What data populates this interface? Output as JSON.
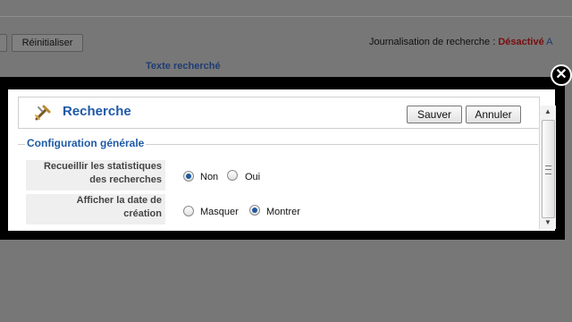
{
  "background": {
    "reset_button": "Réinitialiser",
    "status_prefix": "Journalisation de recherche : ",
    "status_value": "Désactivé",
    "status_extra": "A",
    "heading": "Texte recherché"
  },
  "modal": {
    "title": "Recherche",
    "save_label": "Sauver",
    "cancel_label": "Annuler",
    "close_symbol": "✕",
    "section_title": "Configuration générale",
    "rows": [
      {
        "label_line1": "Recueillir les statistiques",
        "label_line2": "des recherches",
        "options": [
          {
            "label": "Non",
            "checked": true
          },
          {
            "label": "Oui",
            "checked": false
          }
        ]
      },
      {
        "label_line1": "Afficher la date de",
        "label_line2": "création",
        "options": [
          {
            "label": "Masquer",
            "checked": false
          },
          {
            "label": "Montrer",
            "checked": true
          }
        ]
      }
    ]
  },
  "colors": {
    "accent": "#1f5aa6",
    "disabled_status": "#7a0d0d"
  },
  "icons": {
    "toolbar": "search-tool-icon",
    "close": "close-icon"
  }
}
